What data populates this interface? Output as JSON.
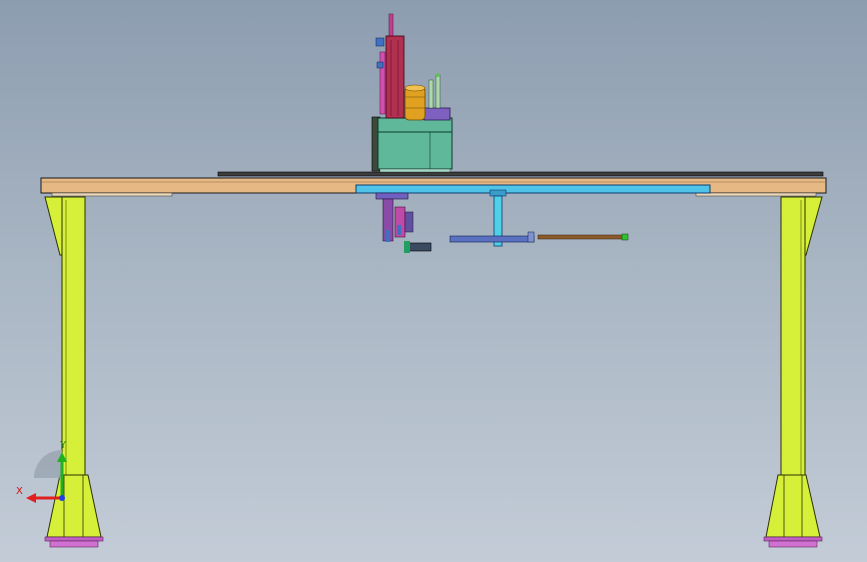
{
  "triad": {
    "x_label": "X",
    "y_label": "Y",
    "x_color": "#e02020",
    "y_color": "#20b020",
    "z_color": "#2040e0"
  },
  "colors": {
    "leg": "#d6f03a",
    "leg_outline": "#2a3000",
    "table_top": "#e6b883",
    "rail": "#4fc3e8",
    "housing": "#5fb89a",
    "foot": "#c060c0"
  }
}
